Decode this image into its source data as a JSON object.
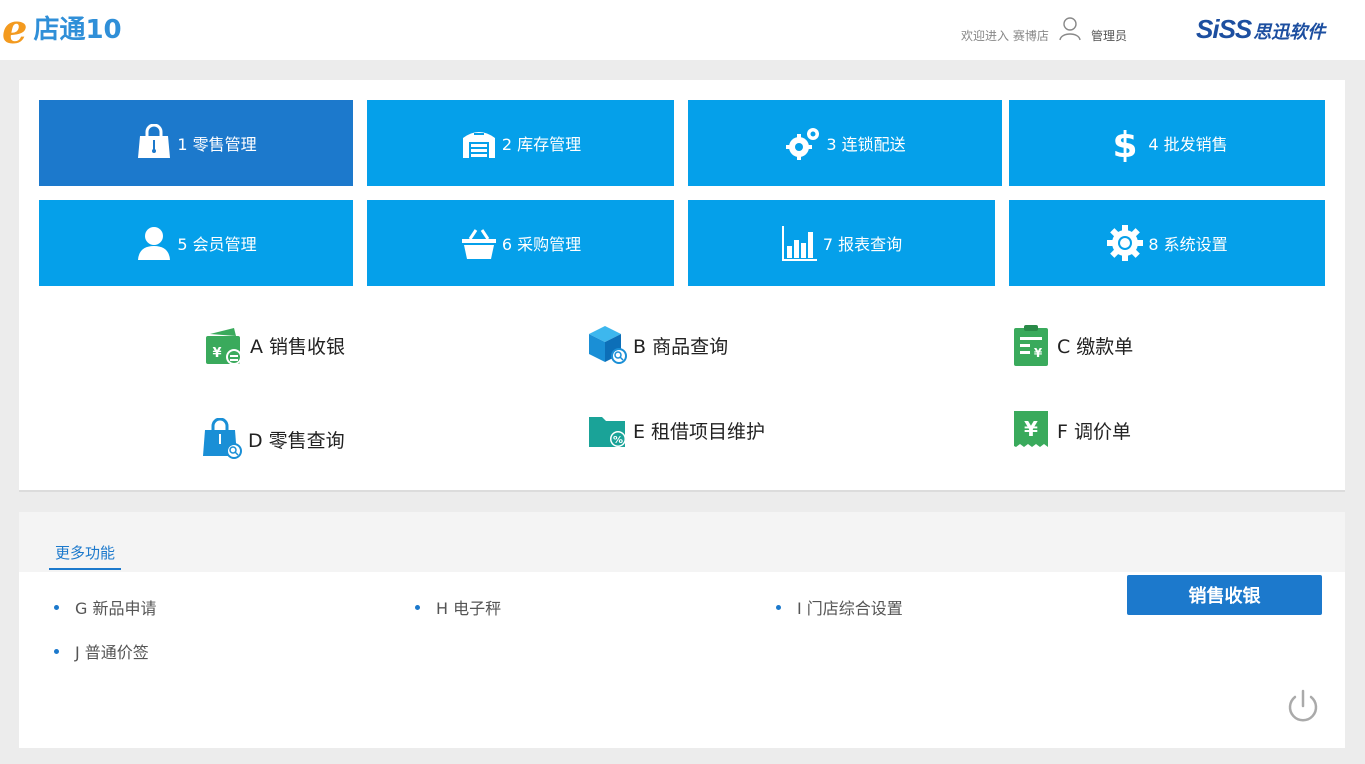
{
  "header": {
    "logo_mark": "e",
    "logo_name": "店通10",
    "welcome": "欢迎进入 赛博店",
    "role": "管理员",
    "brand_latin": "SiSS",
    "brand_cn": "思迅软件"
  },
  "modules": [
    {
      "label": "1 零售管理",
      "icon": "shopping-bag-icon",
      "active": true
    },
    {
      "label": "2 库存管理",
      "icon": "warehouse-icon",
      "active": false
    },
    {
      "label": "3 连锁配送",
      "icon": "gears-icon",
      "active": false
    },
    {
      "label": "4 批发销售",
      "icon": "dollar-icon",
      "active": false
    },
    {
      "label": "5 会员管理",
      "icon": "person-icon",
      "active": false
    },
    {
      "label": "6 采购管理",
      "icon": "basket-icon",
      "active": false
    },
    {
      "label": "7 报表查询",
      "icon": "bar-chart-icon",
      "active": false
    },
    {
      "label": "8 系统设置",
      "icon": "gear-icon",
      "active": false
    }
  ],
  "quick_links": [
    {
      "label": "A 销售收银",
      "icon": "cashier-wallet-icon"
    },
    {
      "label": "B 商品查询",
      "icon": "product-box-search-icon"
    },
    {
      "label": "C 缴款单",
      "icon": "payment-clipboard-icon"
    },
    {
      "label": "D 零售查询",
      "icon": "bag-search-icon"
    },
    {
      "label": "E 租借项目维护",
      "icon": "folder-percent-icon"
    },
    {
      "label": "F 调价单",
      "icon": "price-tag-yen-icon"
    }
  ],
  "more": {
    "tab_label": "更多功能",
    "items": [
      "G 新品申请",
      "H 电子秤",
      "I 门店综合设置",
      "J 普通价签"
    ],
    "primary_button": "销售收银"
  },
  "colors": {
    "tile": "#05a0ea",
    "tile_active": "#1c79cc",
    "accent": "#1c79cc",
    "green": "#3aaa5c",
    "teal": "#1aa398",
    "logo_orange": "#f39a1f"
  }
}
